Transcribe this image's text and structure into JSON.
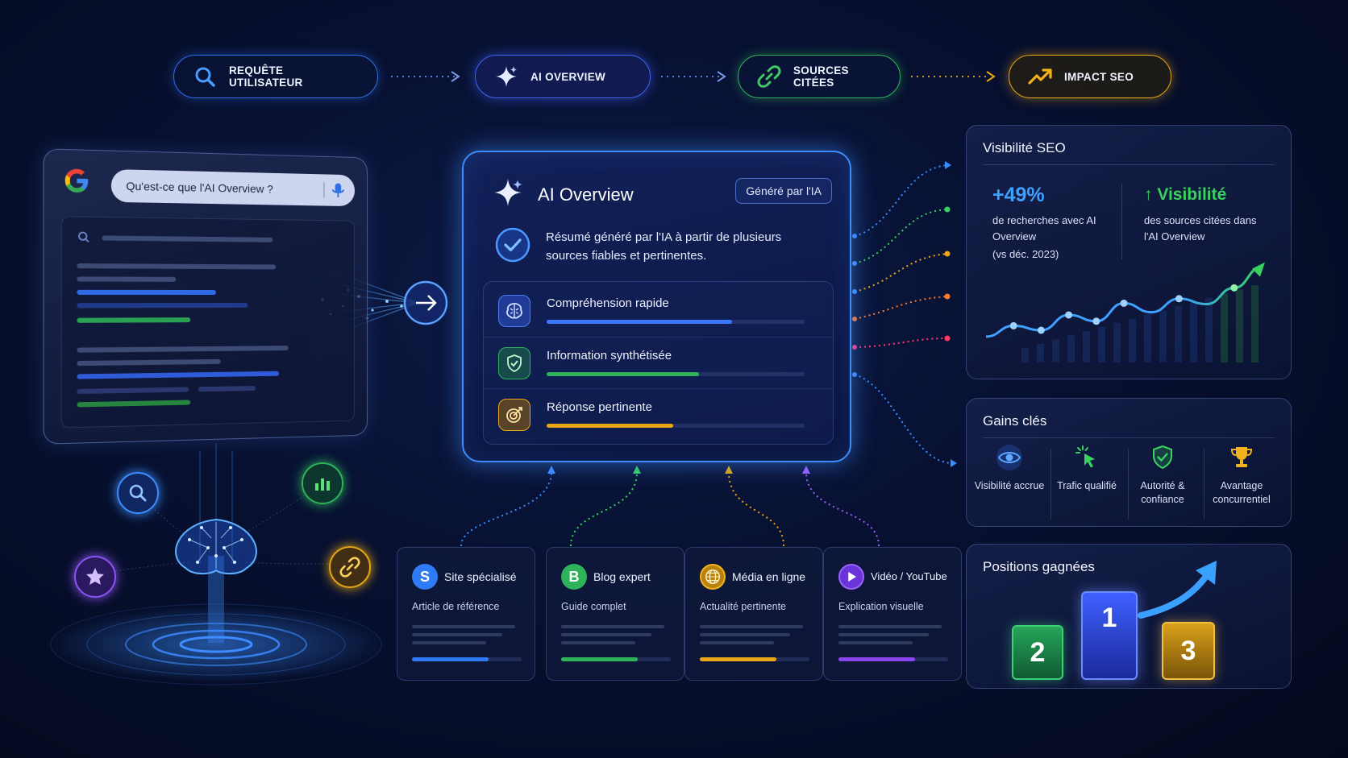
{
  "pipeline": [
    {
      "label": "REQUÊTE UTILISATEUR",
      "icon": "search-icon",
      "color": "#2e6fe8"
    },
    {
      "label": "AI OVERVIEW",
      "icon": "sparkle-icon",
      "color": "#3f63f0"
    },
    {
      "label": "SOURCES CITÉES",
      "icon": "link-icon",
      "color": "#2fb35a"
    },
    {
      "label": "IMPACT SEO",
      "icon": "trend-up-icon",
      "color": "#e7a613"
    }
  ],
  "search": {
    "query": "Qu'est-ce que l'AI Overview ?"
  },
  "overview": {
    "title": "AI Overview",
    "badge": "Généré par l'IA",
    "summary": "Résumé généré par l'IA à partir de plusieurs sources fiables et pertinentes.",
    "features": [
      {
        "label": "Compréhension rapide",
        "icon": "brain-icon",
        "color": "#3a78ff",
        "level": 0.72
      },
      {
        "label": "Information synthétisée",
        "icon": "shield-check-icon",
        "color": "#2fb35a",
        "level": 0.59
      },
      {
        "label": "Réponse pertinente",
        "icon": "target-icon",
        "color": "#e7a613",
        "level": 0.49
      }
    ]
  },
  "sources": [
    {
      "letter": "S",
      "name": "Site spécialisé",
      "desc": "Article de référence",
      "color": "#2f7bf5",
      "level": 0.7
    },
    {
      "letter": "B",
      "name": "Blog expert",
      "desc": "Guide complet",
      "color": "#2fb35a",
      "level": 0.7
    },
    {
      "letter": "",
      "name": "Média en ligne",
      "desc": "Actualité pertinente",
      "color": "#e7a613",
      "level": 0.7
    },
    {
      "letter": "",
      "name": "Vidéo / YouTube",
      "desc": "Explication visuelle",
      "color": "#8a45ef",
      "level": 0.7
    }
  ],
  "visibility": {
    "title": "Visibilité SEO",
    "stat1_value": "+49%",
    "stat1_text": "de recherches avec AI Overview",
    "stat1_note": "(vs déc. 2023)",
    "stat2_value": "↑ Visibilité",
    "stat2_text": "des sources citées dans l'AI Overview",
    "color_primary": "#3ea0ff",
    "color_secondary": "#37d35e"
  },
  "chart_data": {
    "type": "line",
    "title": "",
    "xlabel": "",
    "ylabel": "",
    "x": [
      1,
      2,
      3,
      4,
      5,
      6,
      7,
      8,
      9,
      10,
      11
    ],
    "series": [
      {
        "values": [
          18,
          30,
          25,
          42,
          35,
          55,
          45,
          60,
          54,
          72,
          95
        ]
      }
    ],
    "ylim": [
      0,
      100
    ],
    "grid": false
  },
  "gains": {
    "title": "Gains clés",
    "items": [
      {
        "label": "Visibilité accrue",
        "icon": "eye-icon",
        "color": "#3ea0ff"
      },
      {
        "label": "Trafic qualifié",
        "icon": "cursor-click-icon",
        "color": "#37d35e"
      },
      {
        "label": "Autorité & confiance",
        "icon": "shield-check-icon",
        "color": "#37d35e"
      },
      {
        "label": "Avantage concurrentiel",
        "icon": "trophy-icon",
        "color": "#e7a613"
      }
    ]
  },
  "positions": {
    "title": "Positions gagnées",
    "podium": [
      "2",
      "1",
      "3"
    ]
  }
}
